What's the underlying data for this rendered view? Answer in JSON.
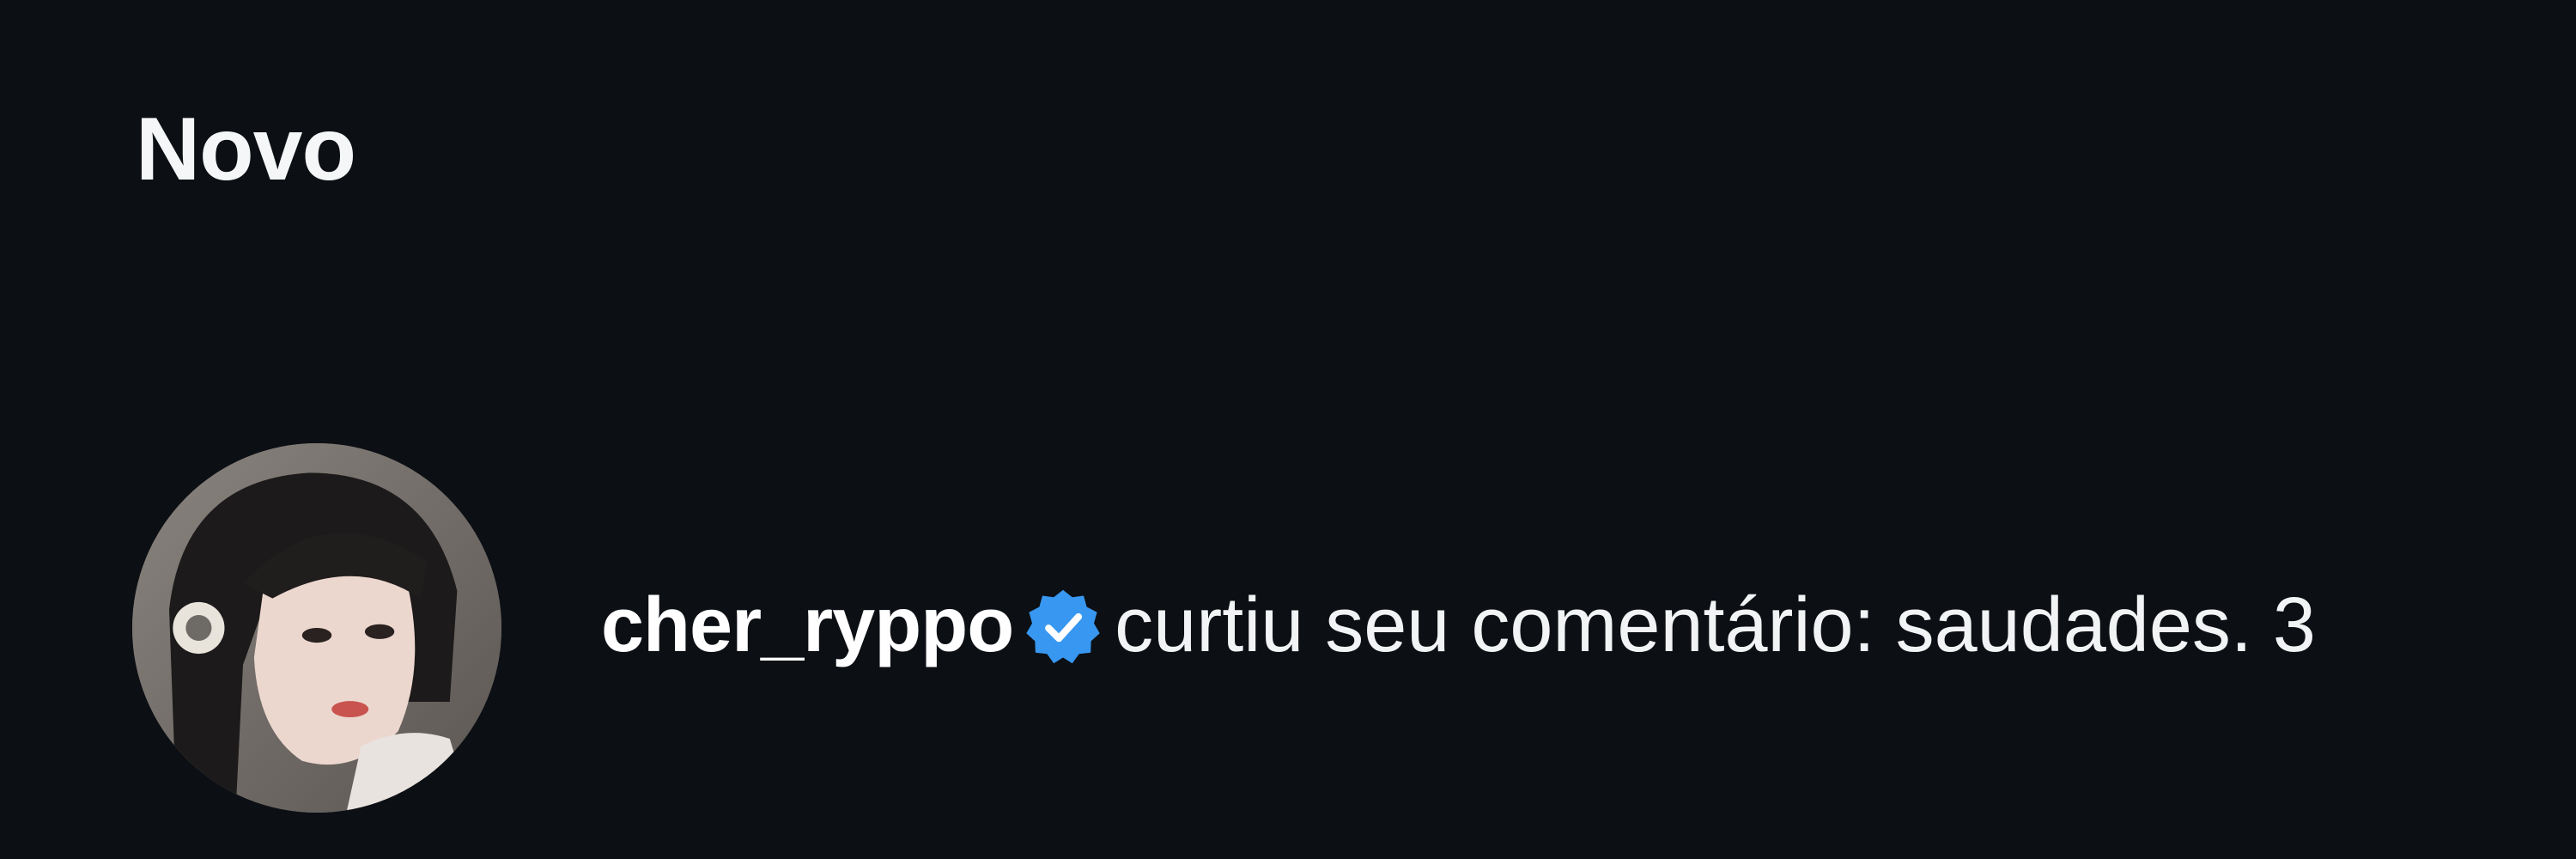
{
  "section": {
    "title": "Novo"
  },
  "notification": {
    "username": "cher_ryppo",
    "verified_icon": "verified-badge-icon",
    "action": "curtiu seu comentário:",
    "comment": "saudades.",
    "time_partial": "3"
  },
  "colors": {
    "background": "#0c0f14",
    "text": "#f5f6f8",
    "verified": "#3897f0"
  }
}
